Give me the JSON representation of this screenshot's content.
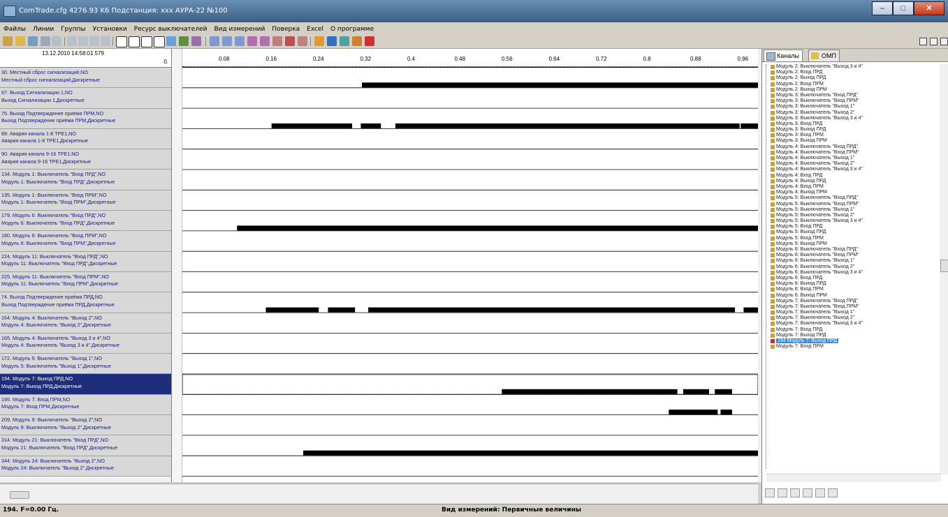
{
  "window": {
    "title": "ComTrade.cfg 4276.93 K6    Подстанция: xxx  АУРА-22  №100",
    "minimize": "–",
    "maximize": "□",
    "close": "✕"
  },
  "menu": [
    "Файлы",
    "Линии",
    "Группы",
    "Установки",
    "Ресурс выключателей",
    "Вид измерений",
    "Поверка",
    "Excel",
    "О программе"
  ],
  "plot_header": {
    "datetime": "13.12.2010 14:58:01.579",
    "origin": "0."
  },
  "ruler_ticks": [
    "0.08",
    "0.16",
    "0.24",
    "0.32",
    "0.4",
    "0.48",
    "0.56",
    "0.64",
    "0.72",
    "0.8",
    "0.88",
    "0.96"
  ],
  "channels": [
    {
      "line1": "30. Местный сброс сигнализаций,NO",
      "line2": "Местный сброс сигнализаций,Дискретные"
    },
    {
      "line1": "67. Выход Сигнализации 1,NO",
      "line2": "Выход Сигнализации 1,Дискретные"
    },
    {
      "line1": "75. Выход Подтверждение приёма ПРМ,NO",
      "line2": "Выход Подтверждение приёма ПРМ,Дискретные"
    },
    {
      "line1": "89. Авария канала 1-8 ТРЕ1,NO",
      "line2": "Авария канала 1-8 ТРЕ1,Дискретные"
    },
    {
      "line1": "90. Авария канала 9-16 ТРЕ1,NO",
      "line2": "Авария канала 9-16 ТРЕ1,Дискретные"
    },
    {
      "line1": "134. Модуль 1: Выключатель \"Вход ПРД\",NO",
      "line2": "Модуль 1: Выключатель \"Вход ПРД\",Дискретные"
    },
    {
      "line1": "135. Модуль 1: Выключатель \"Вход ПРМ\",NO",
      "line2": "Модуль 1: Выключатель \"Вход ПРМ\",Дискретные"
    },
    {
      "line1": "179. Модуль 6: Выключатель \"Вход ПРД\",NO",
      "line2": "Модуль 6: Выключатель \"Вход ПРД\",Дискретные"
    },
    {
      "line1": "180. Модуль 6: Выключатель \"Вход ПРМ\",NO",
      "line2": "Модуль 6: Выключатель \"Вход ПРМ\",Дискретные"
    },
    {
      "line1": "224. Модуль 11: Выключатель \"Вход ПРД\",NO",
      "line2": "Модуль 11: Выключатель \"Вход ПРД\",Дискретные"
    },
    {
      "line1": "225. Модуль 11: Выключатель \"Вход ПРМ\",NO",
      "line2": "Модуль 11: Выключатель \"Вход ПРМ\",Дискретные"
    },
    {
      "line1": "74. Выход Подтверждение приёма ПРД,NO",
      "line2": "Выход Подтверждение приёма ПРД,Дискретные"
    },
    {
      "line1": "164. Модуль 4: Выключатель \"Выход 2\",NO",
      "line2": "Модуль 4: Выключатель \"Выход 2\",Дискретные"
    },
    {
      "line1": "165. Модуль 4: Выключатель \"Выход 3 и 4\",NO",
      "line2": "Модуль 4: Выключатель \"Выход 3 и 4\",Дискретные"
    },
    {
      "line1": "172. Модуль 5: Выключатель \"Выход 1\",NO",
      "line2": "Модуль 5: Выключатель \"Выход 1\",Дискретные"
    },
    {
      "line1": "194. Модуль 7: Выход ПРД,NO",
      "line2": "Модуль 7: Выход ПРД,Дискретные",
      "selected": true
    },
    {
      "line1": "195. Модуль 7: Вход ПРМ,NO",
      "line2": "Модуль 7: Вход ПРМ,Дискретные"
    },
    {
      "line1": "209. Модуль 9: Выключатель \"Выход 2\",NO",
      "line2": "Модуль 9: Выключатель \"Выход 2\",Дискретные"
    },
    {
      "line1": "314. Модуль 21: Выключатель \"Вход ПРД\",NO",
      "line2": "Модуль 21: Выключатель \"Вход ПРД\",Дискретные"
    },
    {
      "line1": "344. Модуль 24: Выключатель \"Выход 2\",NO",
      "line2": "Модуль 24: Выключатель \"Выход 2\",Дискретные"
    }
  ],
  "signals": [
    [
      [
        0.312,
        1.0
      ]
    ],
    [],
    [
      [
        0.155,
        0.295
      ],
      [
        0.31,
        0.345
      ],
      [
        0.37,
        0.968
      ],
      [
        0.97,
        1.0
      ]
    ],
    [],
    [],
    [],
    [],
    [
      [
        0.095,
        1.0
      ]
    ],
    [],
    [],
    [],
    [
      [
        0.145,
        0.237
      ],
      [
        0.253,
        0.3
      ],
      [
        0.323,
        0.96
      ],
      [
        0.975,
        1.0
      ]
    ],
    [],
    [],
    [],
    [
      [
        0.555,
        0.605
      ],
      [
        0.605,
        0.86
      ],
      [
        0.87,
        0.915
      ],
      [
        0.925,
        0.955
      ]
    ],
    [
      [
        0.845,
        0.93
      ],
      [
        0.935,
        0.955
      ]
    ],
    [],
    [
      [
        0.21,
        1.0
      ]
    ],
    []
  ],
  "tabs": {
    "channels": "Каналы",
    "omp": "ОМП"
  },
  "tree": [
    "Модуль 2: Выключатель \"Выход 3 и 4\"",
    "Модуль 2: Вход ПРД",
    "Модуль 2: Выход ПРД",
    "Модуль 2: Вход ПРМ",
    "Модуль 2: Выход ПРМ",
    "Модуль 3: Выключатель \"Вход ПРД\"",
    "Модуль 3: Выключатель \"Вход ПРМ\"",
    "Модуль 3: Выключатель \"Выход 1\"",
    "Модуль 3: Выключатель \"Выход 2\"",
    "Модуль 3: Выключатель \"Выход 3 и 4\"",
    "Модуль 3: Вход ПРД",
    "Модуль 3: Выход ПРД",
    "Модуль 3: Вход ПРМ",
    "Модуль 3: Выход ПРМ",
    "Модуль 4: Выключатель \"Вход ПРД\"",
    "Модуль 4: Выключатель \"Вход ПРМ\"",
    "Модуль 4: Выключатель \"Выход 1\"",
    "Модуль 4: Выключатель \"Выход 2\"",
    "Модуль 4: Выключатель \"Выход 3 и 4\"",
    "Модуль 4: Вход ПРД",
    "Модуль 4: Выход ПРД",
    "Модуль 4: Вход ПРМ",
    "Модуль 4: Выход ПРМ",
    "Модуль 5: Выключатель \"Вход ПРД\"",
    "Модуль 5: Выключатель \"Вход ПРМ\"",
    "Модуль 5: Выключатель \"Выход 1\"",
    "Модуль 5: Выключатель \"Выход 2\"",
    "Модуль 5: Выключатель \"Выход 3 и 4\"",
    "Модуль 5: Вход ПРД",
    "Модуль 5: Выход ПРД",
    "Модуль 5: Вход ПРМ",
    "Модуль 5: Выход ПРМ",
    "Модуль 6: Выключатель \"Вход ПРД\"",
    "Модуль 6: Выключатель \"Вход ПРМ\"",
    "Модуль 6: Выключатель \"Выход 1\"",
    "Модуль 6: Выключатель \"Выход 2\"",
    "Модуль 6: Выключатель \"Выход 3 и 4\"",
    "Модуль 6: Вход ПРД",
    "Модуль 6: Выход ПРД",
    "Модуль 6: Вход ПРМ",
    "Модуль 6: Выход ПРМ",
    "Модуль 7: Выключатель \"Вход ПРД\"",
    "Модуль 7: Выключатель \"Вход ПРМ\"",
    "Модуль 7: Выключатель \"Выход 1\"",
    "Модуль 7: Выключатель \"Выход 2\"",
    "Модуль 7: Выключатель \"Выход 3 и 4\"",
    "Модуль 7: Вход ПРД",
    "Модуль 7: Выход ПРД"
  ],
  "tree_selected": "194 Модуль 7: Выход ПРД",
  "tree_last": "Модуль 7: Вход ПРМ",
  "status": {
    "left": "194. F=0.00 Гц.",
    "center": "Вид измерений: Первичные величины"
  },
  "colors": {
    "selected_row": "#1e2e7a",
    "channel_text": "#1a1a80",
    "signal": "#000000",
    "tree_highlight": "#3b8de0"
  }
}
